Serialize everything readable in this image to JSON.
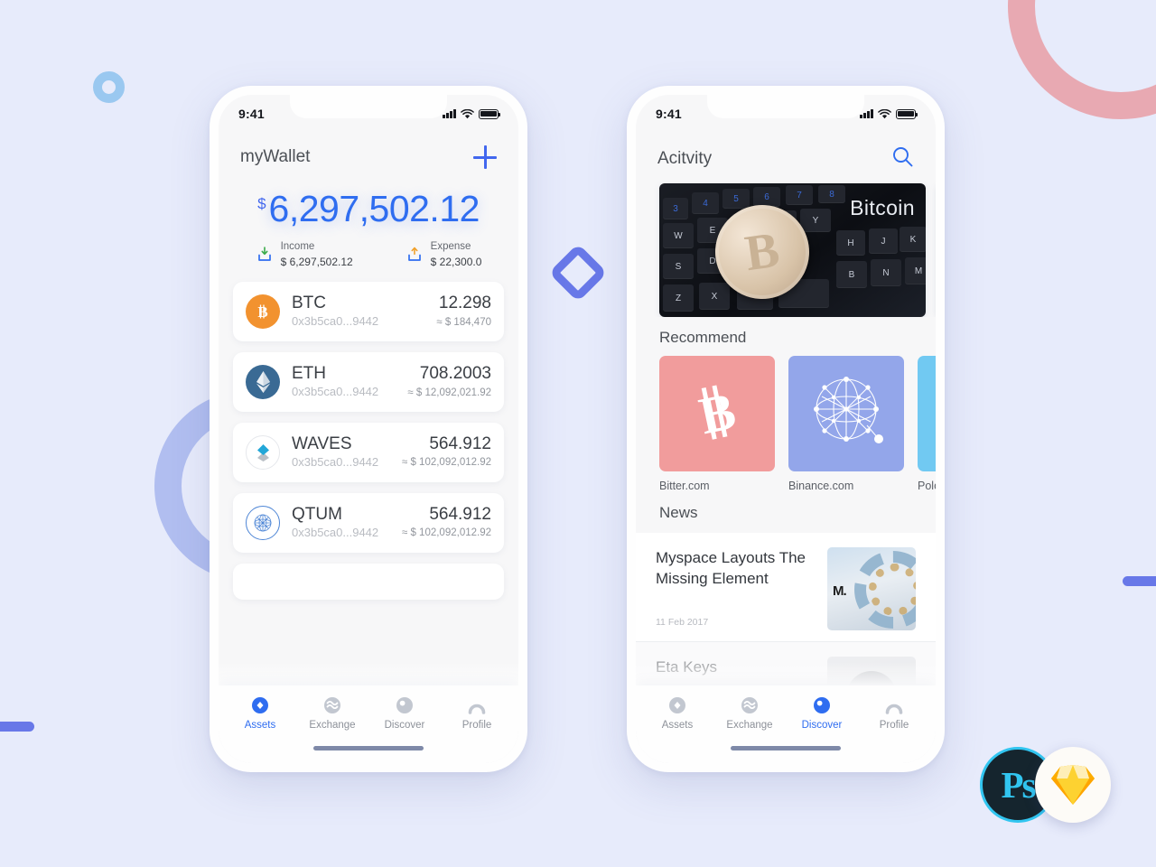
{
  "background": {
    "color": "#e7ebfb",
    "accent_blue": "#6878e8",
    "accent_pink": "#e8a9b2",
    "accent_periwinkle": "#b1bef0",
    "accent_lightblue": "#9ac8f0"
  },
  "logos": {
    "photoshop_label": "Ps",
    "sketch_label": "sketch-diamond-icon"
  },
  "wallet_screen": {
    "status": {
      "time": "9:41"
    },
    "header": {
      "title": "myWallet",
      "add_label": "+"
    },
    "balance": {
      "currency": "$",
      "amount": "6,297,502.12"
    },
    "summary": [
      {
        "label": "Income",
        "value": "$ 6,297,502.12"
      },
      {
        "label": "Expense",
        "value": "$ 22,300.0"
      }
    ],
    "assets": [
      {
        "symbol": "BTC",
        "address": "0x3b5ca0...9442",
        "amount": "12.298",
        "usd": "≈ $ 184,470",
        "color": "#f2922f",
        "icon": "btc-icon"
      },
      {
        "symbol": "ETH",
        "address": "0x3b5ca0...9442",
        "amount": "708.2003",
        "usd": "≈ $ 12,092,021.92",
        "color": "#3a6a94",
        "icon": "eth-icon"
      },
      {
        "symbol": "WAVES",
        "address": "0x3b5ca0...9442",
        "amount": "564.912",
        "usd": "≈ $ 102,092,012.92",
        "color": "#ffffff",
        "icon": "waves-icon"
      },
      {
        "symbol": "QTUM",
        "address": "0x3b5ca0...9442",
        "amount": "564.912",
        "usd": "≈ $ 102,092,012.92",
        "color": "#ffffff",
        "icon": "qtum-icon"
      }
    ],
    "tabs": [
      {
        "label": "Assets",
        "icon": "assets-icon",
        "active": true
      },
      {
        "label": "Exchange",
        "icon": "exchange-icon",
        "active": false
      },
      {
        "label": "Discover",
        "icon": "discover-icon",
        "active": false
      },
      {
        "label": "Profile",
        "icon": "profile-icon",
        "active": false
      }
    ]
  },
  "activity_screen": {
    "status": {
      "time": "9:41"
    },
    "header": {
      "title": "Acitvity",
      "search_icon": "search-icon"
    },
    "banner": {
      "label": "Bitcoin"
    },
    "recommend": {
      "title": "Recommend",
      "items": [
        {
          "name": "Bitter.com",
          "color": "#f19c9c",
          "icon": "bitcoin-glyph-icon"
        },
        {
          "name": "Binance.com",
          "color": "#93a6ea",
          "icon": "network-graph-icon"
        },
        {
          "name": "Polonie",
          "color": "#71c9f2",
          "icon": "star-icon"
        }
      ]
    },
    "news": {
      "title": "News",
      "items": [
        {
          "headline": "Myspace Layouts The Missing Element",
          "date": "11 Feb 2017",
          "thumb": "ibm-bearing-image"
        },
        {
          "headline": "Eta Keys",
          "date": "",
          "thumb": "portrait-image"
        }
      ]
    },
    "tabs": [
      {
        "label": "Assets",
        "icon": "assets-icon",
        "active": false
      },
      {
        "label": "Exchange",
        "icon": "exchange-icon",
        "active": false
      },
      {
        "label": "Discover",
        "icon": "discover-icon",
        "active": true
      },
      {
        "label": "Profile",
        "icon": "profile-icon",
        "active": false
      }
    ]
  }
}
